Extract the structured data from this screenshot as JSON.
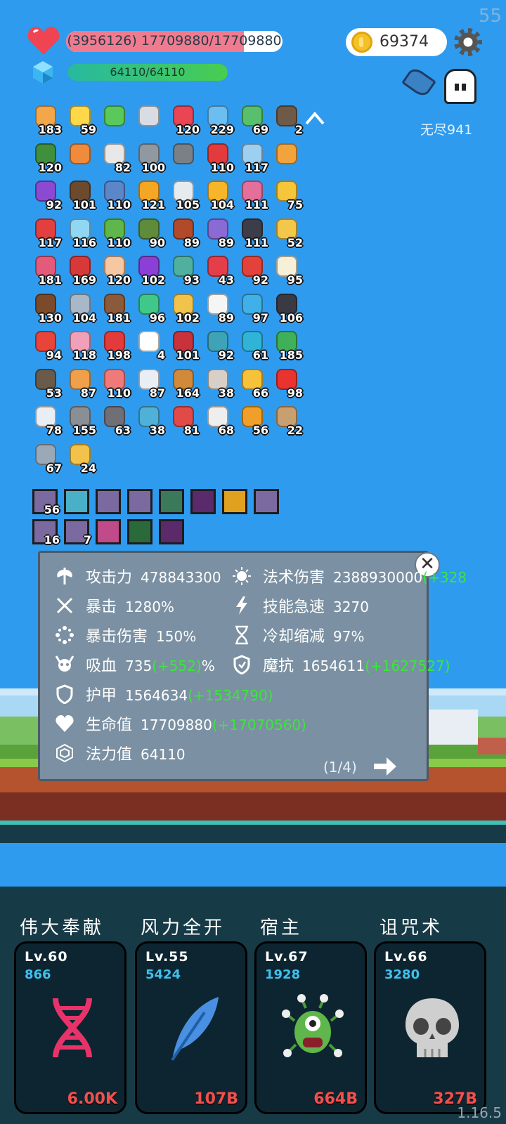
{
  "fps": "55",
  "version": "1.16.5",
  "hp": {
    "text": "(3956126) 17709880/17709880",
    "fill": 0.82
  },
  "mp": {
    "text": "64110/64110",
    "fill": 1.0
  },
  "gold": "69374",
  "mode": "无尽941",
  "items": [
    {
      "n": "183",
      "c": "#f4a64a"
    },
    {
      "n": "59",
      "c": "#ffd84a"
    },
    {
      "n": "",
      "c": "#59c95b"
    },
    {
      "n": "",
      "c": "#d9dde3"
    },
    {
      "n": "120",
      "c": "#e94552"
    },
    {
      "n": "229",
      "c": "#6bbef2"
    },
    {
      "n": "69",
      "c": "#58c06c"
    },
    {
      "n": "2",
      "c": "#6f5a48"
    },
    {
      "n": "120",
      "c": "#3f8f3c"
    },
    {
      "n": "",
      "c": "#f08a3c"
    },
    {
      "n": "82",
      "c": "#e8e8e8"
    },
    {
      "n": "100",
      "c": "#9098a0"
    },
    {
      "n": "",
      "c": "#7b7f86"
    },
    {
      "n": "110",
      "c": "#e33b3b"
    },
    {
      "n": "117",
      "c": "#9ccff0"
    },
    {
      "n": "",
      "c": "#f2a33b"
    },
    {
      "n": "92",
      "c": "#8c4ad3"
    },
    {
      "n": "101",
      "c": "#6b4a2e"
    },
    {
      "n": "110",
      "c": "#5b86c8"
    },
    {
      "n": "121",
      "c": "#f5a623"
    },
    {
      "n": "105",
      "c": "#e6ebef"
    },
    {
      "n": "104",
      "c": "#f7b52a"
    },
    {
      "n": "111",
      "c": "#e46f9a"
    },
    {
      "n": "75",
      "c": "#f5c53a"
    },
    {
      "n": "117",
      "c": "#e23f3f"
    },
    {
      "n": "116",
      "c": "#8fd7f2"
    },
    {
      "n": "110",
      "c": "#5fb64a"
    },
    {
      "n": "90",
      "c": "#5e8c3a"
    },
    {
      "n": "89",
      "c": "#b04a2a"
    },
    {
      "n": "89",
      "c": "#8a6ad4"
    },
    {
      "n": "111",
      "c": "#3d3d4a"
    },
    {
      "n": "52",
      "c": "#f2c74a"
    },
    {
      "n": "181",
      "c": "#e45a7a"
    },
    {
      "n": "169",
      "c": "#d93838"
    },
    {
      "n": "120",
      "c": "#f5c7a2"
    },
    {
      "n": "102",
      "c": "#8b3fd6"
    },
    {
      "n": "93",
      "c": "#4fb0a0"
    },
    {
      "n": "43",
      "c": "#e53e4b"
    },
    {
      "n": "92",
      "c": "#e2423a"
    },
    {
      "n": "95",
      "c": "#f7f0d8"
    },
    {
      "n": "130",
      "c": "#7a4a2a"
    },
    {
      "n": "104",
      "c": "#a8b8c8"
    },
    {
      "n": "181",
      "c": "#8a5a3a"
    },
    {
      "n": "96",
      "c": "#3fc88a"
    },
    {
      "n": "102",
      "c": "#f2c34a"
    },
    {
      "n": "89",
      "c": "#f5f5f5"
    },
    {
      "n": "97",
      "c": "#3fb0e8"
    },
    {
      "n": "106",
      "c": "#3a3a44"
    },
    {
      "n": "94",
      "c": "#e8443a"
    },
    {
      "n": "118",
      "c": "#f0a0b8"
    },
    {
      "n": "198",
      "c": "#e33b3b"
    },
    {
      "n": "4",
      "c": "#ffffff"
    },
    {
      "n": "101",
      "c": "#c8323a"
    },
    {
      "n": "92",
      "c": "#3fa3b8"
    },
    {
      "n": "61",
      "c": "#2fb4d8"
    },
    {
      "n": "185",
      "c": "#3fb05a"
    },
    {
      "n": "53",
      "c": "#6a5a4a"
    },
    {
      "n": "87",
      "c": "#f0a04a"
    },
    {
      "n": "110",
      "c": "#f07a7a"
    },
    {
      "n": "87",
      "c": "#e8eef4"
    },
    {
      "n": "164",
      "c": "#d08a3a"
    },
    {
      "n": "38",
      "c": "#d8d0c8"
    },
    {
      "n": "66",
      "c": "#f5c23a"
    },
    {
      "n": "98",
      "c": "#e8332f"
    },
    {
      "n": "78",
      "c": "#e8eef4"
    },
    {
      "n": "155",
      "c": "#8a8f96"
    },
    {
      "n": "63",
      "c": "#6f6f78"
    },
    {
      "n": "38",
      "c": "#4fb0d8"
    },
    {
      "n": "81",
      "c": "#e24a4a"
    },
    {
      "n": "68",
      "c": "#eeeeee"
    },
    {
      "n": "56",
      "c": "#f0a02a"
    },
    {
      "n": "22",
      "c": "#c8a070"
    },
    {
      "n": "67",
      "c": "#9aa8b8"
    },
    {
      "n": "24",
      "c": "#f2c24a"
    }
  ],
  "gear_row1": [
    {
      "n": "56",
      "c": "#7a6aa0"
    },
    {
      "n": "",
      "c": "#4ab0c8"
    },
    {
      "n": "",
      "c": "#7a6aa0"
    },
    {
      "n": "",
      "c": "#7a6aa0"
    },
    {
      "n": "",
      "c": "#3a7a5a"
    },
    {
      "n": "",
      "c": "#5a2a6a"
    },
    {
      "n": "",
      "c": "#e0a020"
    },
    {
      "n": "",
      "c": "#7a6aa0"
    }
  ],
  "gear_row2": [
    {
      "n": "16",
      "c": "#7a6aa0"
    },
    {
      "n": "7",
      "c": "#7a6aa0"
    },
    {
      "n": "",
      "c": "#c04a8a"
    },
    {
      "n": "",
      "c": "#2a6a3a"
    },
    {
      "n": "",
      "c": "#5a2a6a"
    }
  ],
  "stats_left": [
    {
      "label": "攻击力",
      "value": "478843300",
      "bonus": "",
      "icon": "axe-icon"
    },
    {
      "label": "暴击",
      "value": "1280%",
      "bonus": "",
      "icon": "crit-icon"
    },
    {
      "label": "暴击伤害",
      "value": "150%",
      "bonus": "",
      "icon": "crit-damage-icon"
    },
    {
      "label": "吸血",
      "value": "735",
      "bonus": "(+552)",
      "suffix": "%",
      "icon": "horned-skull-icon"
    },
    {
      "label": "护甲",
      "value": "1564634",
      "bonus": "(+1534790)",
      "icon": "shield-icon"
    },
    {
      "label": "生命值",
      "value": "17709880",
      "bonus": "(+17070560)",
      "icon": "heart-icon"
    },
    {
      "label": "法力值",
      "value": "64110",
      "bonus": "",
      "icon": "mana-gem-icon"
    }
  ],
  "stats_right": [
    {
      "label": "法术伤害",
      "value": "2388930000",
      "bonus": "(+328",
      "icon": "sun-icon"
    },
    {
      "label": "技能急速",
      "value": "3270",
      "bonus": "",
      "icon": "lightning-icon"
    },
    {
      "label": "冷却缩减",
      "value": "97%",
      "bonus": "",
      "icon": "hourglass-icon"
    },
    {
      "label": "魔抗",
      "value": "1654611",
      "bonus": "(+1627527)",
      "icon": "magic-shield-icon"
    }
  ],
  "stats_page": "(1/4)",
  "skills": [
    {
      "title": "伟大奉献",
      "lv": "Lv.60",
      "pts": "866",
      "cost": "6.00K",
      "icon": "dna-icon"
    },
    {
      "title": "风力全开",
      "lv": "Lv.55",
      "pts": "5424",
      "cost": "107B",
      "icon": "feather-icon"
    },
    {
      "title": "宿主",
      "lv": "Lv.67",
      "pts": "1928",
      "cost": "664B",
      "icon": "virus-monster-icon"
    },
    {
      "title": "诅咒术",
      "lv": "Lv.66",
      "pts": "3280",
      "cost": "327B",
      "icon": "skull-icon"
    }
  ]
}
